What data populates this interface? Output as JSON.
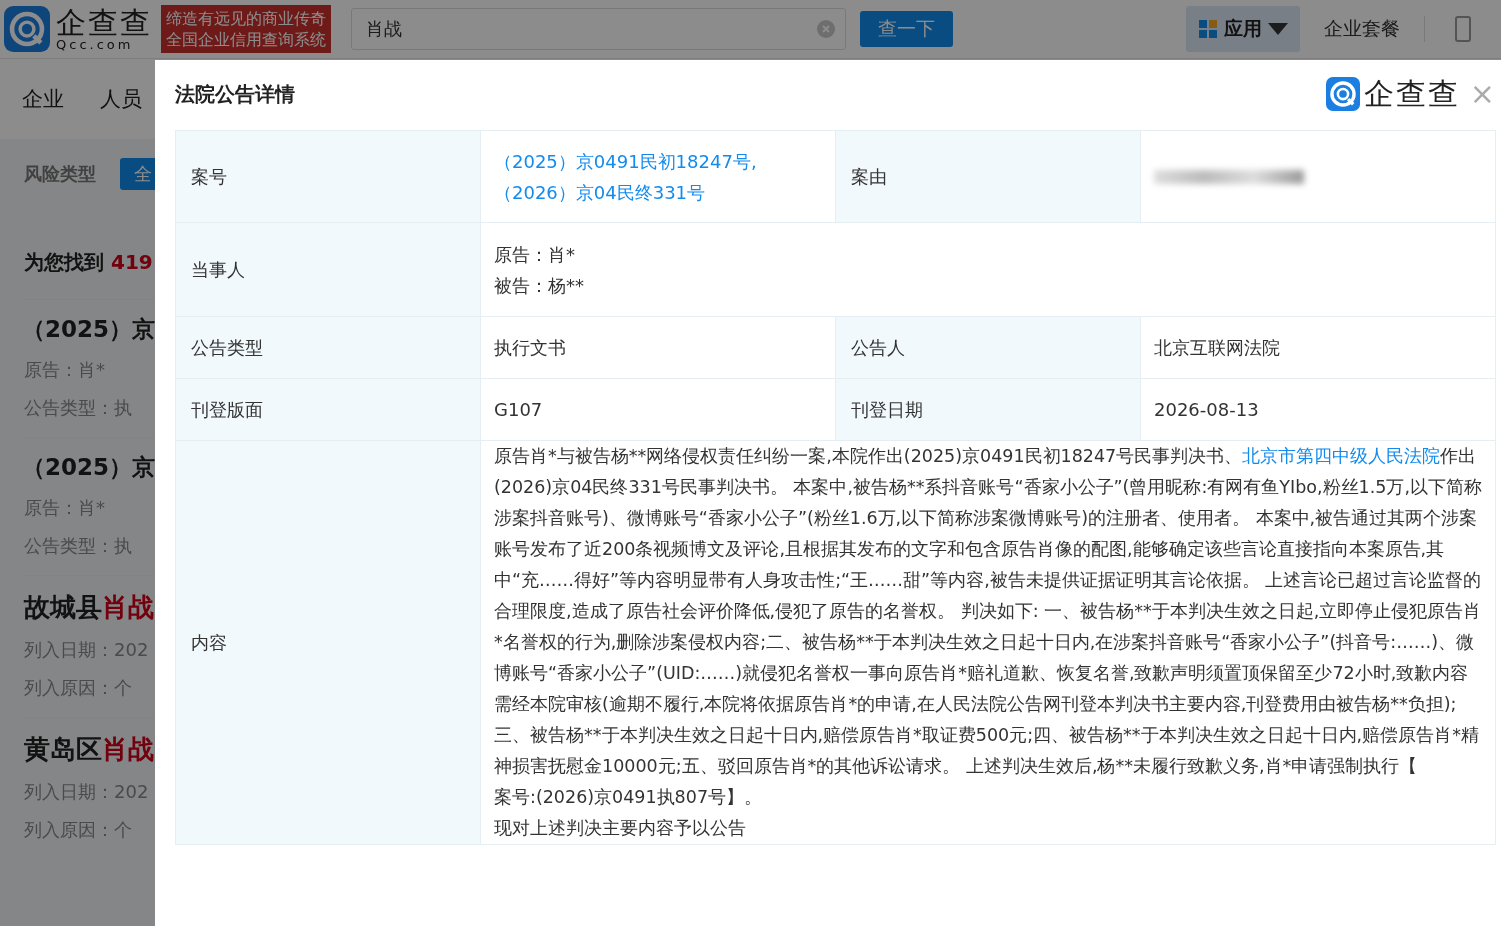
{
  "header": {
    "logo_text": "企查查",
    "logo_domain": "Qcc.com",
    "slogan": [
      "缔造有远见的商业传奇",
      "全国企业信用查询系统"
    ],
    "search": {
      "value": "肖战"
    },
    "search_button": "查一下",
    "menu": [
      {
        "kind": "dropdown",
        "label": "应用"
      },
      {
        "kind": "link",
        "label": "企业套餐"
      }
    ]
  },
  "nav": {
    "tabs": [
      "企业",
      "人员"
    ]
  },
  "filter": {
    "label": "风险类型",
    "option": "全"
  },
  "results": {
    "count_prefix": "为您找到",
    "count": "419",
    "items": [
      {
        "kind": "case",
        "title": [
          {
            "text": "（2025）京"
          }
        ],
        "lines": [
          "原告：肖*",
          "公告类型：执"
        ]
      },
      {
        "kind": "case",
        "title": [
          {
            "text": "（2025）京"
          }
        ],
        "lines": [
          "原告：肖*",
          "公告类型：执"
        ]
      },
      {
        "kind": "entity",
        "title": [
          {
            "text": "故城县"
          },
          {
            "text": "肖战",
            "highlight": true
          }
        ],
        "lines": [
          "列入日期：202",
          "列入原因：个"
        ]
      },
      {
        "kind": "entity",
        "title": [
          {
            "text": "黄岛区"
          },
          {
            "text": "肖战",
            "highlight": true
          }
        ],
        "lines": [
          "列入日期：202",
          "列入原因：个"
        ]
      }
    ]
  },
  "modal": {
    "title": "法院公告详情",
    "brand": "企查查",
    "close": "×",
    "rows": [
      {
        "cells": [
          {
            "kind": "label",
            "text": "案号"
          },
          {
            "kind": "link",
            "text": "（2025）京0491民初18247号,（2026）京04民终331号"
          },
          {
            "kind": "label",
            "text": "案由"
          },
          {
            "kind": "redacted"
          }
        ]
      },
      {
        "cells": [
          {
            "kind": "label",
            "text": "当事人"
          },
          {
            "kind": "lines",
            "colspan": 3,
            "lines": [
              "原告：肖*",
              "被告：杨**"
            ]
          }
        ]
      },
      {
        "cells": [
          {
            "kind": "label",
            "text": "公告类型"
          },
          {
            "kind": "value",
            "text": "执行文书"
          },
          {
            "kind": "label",
            "text": "公告人"
          },
          {
            "kind": "value",
            "text": "北京互联网法院"
          }
        ]
      },
      {
        "cells": [
          {
            "kind": "label",
            "text": "刊登版面"
          },
          {
            "kind": "value",
            "text": "G107"
          },
          {
            "kind": "label",
            "text": "刊登日期"
          },
          {
            "kind": "value",
            "text": "2026-08-13"
          }
        ]
      },
      {
        "cells": [
          {
            "kind": "label",
            "text": "内容"
          },
          {
            "kind": "content",
            "colspan": 3,
            "paragraphs": [
              [
                {
                  "text": "原告肖*与被告杨**网络侵权责任纠纷一案,本院作出(2025)京0491民初18247号民事判决书、"
                },
                {
                  "text": "北京市第四中级人民法院",
                  "link": true
                },
                {
                  "text": "作出(2026)京04民终331号民事判决书。 本案中,被告杨**系抖音账号“香家小公子”(曾用昵称:有网有鱼YIbo,粉丝1.5万,以下简称涉案抖音账号)、微博账号“香家小公子”(粉丝1.6万,以下简称涉案微博账号)的注册者、使用者。 本案中,被告通过其两个涉案账号发布了近200条视频博文及评论,且根据其发布的文字和包含原告肖像的配图,能够确定该些言论直接指向本案原告,其中“充……得好”等内容明显带有人身攻击性;“王……甜”等内容,被告未提供证据证明其言论依据。 上述言论已超过言论监督的合理限度,造成了原告社会评价降低,侵犯了原告的名誉权。 判决如下: 一、被告杨**于本判决生效之日起,立即停止侵犯原告肖*名誉权的行为,删除涉案侵权内容;二、被告杨**于本判决生效之日起十日内,在涉案抖音账号“香家小公子”(抖音号:……)、微博账号“香家小公子”(UID:……)就侵犯名誉权一事向原告肖*赔礼道歉、恢复名誉,致歉声明须置顶保留至少72小时,致歉内容需经本院审核(逾期不履行,本院将依据原告肖*的申请,在人民法院公告网刊登本判决书主要内容,刊登费用由被告杨**负担);三、被告杨**于本判决生效之日起十日内,赔偿原告肖*取证费500元;四、被告杨**于本判决生效之日起十日内,赔偿原告肖*精神损害抚慰金10000元;五、驳回原告肖*的其他诉讼请求。 上述判决生效后,杨**未履行致歉义务,肖*申请强制执行【"
                }
              ],
              [
                {
                  "text": "案号:(2026)京0491执807号】。"
                }
              ],
              [
                {
                  "text": "现对上述判决主要内容予以公告"
                }
              ]
            ]
          }
        ]
      }
    ]
  }
}
